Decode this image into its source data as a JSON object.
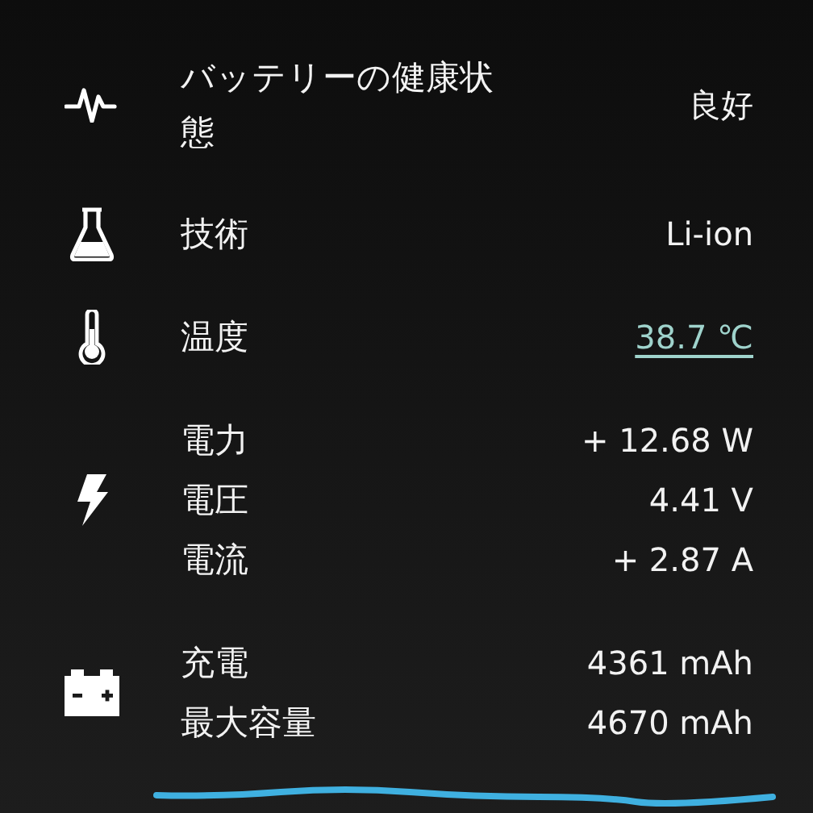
{
  "groups": [
    {
      "kind": "health",
      "rows": [
        {
          "label": "バッテリーの健康状態",
          "value": "良好",
          "kind": "plain"
        }
      ]
    },
    {
      "kind": "technology",
      "rows": [
        {
          "label": "技術",
          "value": "Li-ion",
          "kind": "plain"
        }
      ]
    },
    {
      "kind": "temperature",
      "rows": [
        {
          "label": "温度",
          "value": "38.7 ℃",
          "kind": "link"
        }
      ]
    },
    {
      "kind": "power",
      "rows": [
        {
          "label": "電力",
          "value": "+ 12.68 W",
          "kind": "plain"
        },
        {
          "label": "電圧",
          "value": "4.41 V",
          "kind": "plain"
        },
        {
          "label": "電流",
          "value": "+ 2.87 A",
          "kind": "plain"
        }
      ]
    },
    {
      "kind": "capacity",
      "rows": [
        {
          "label": "充電",
          "value": "4361 mAh",
          "kind": "plain"
        },
        {
          "label": "最大容量",
          "value": "4670 mAh",
          "kind": "plain"
        }
      ]
    }
  ]
}
